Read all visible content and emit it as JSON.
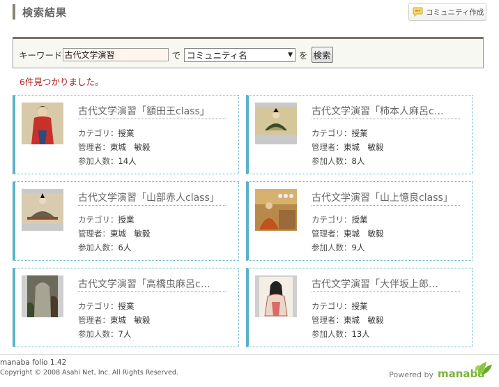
{
  "header": {
    "title": "検索結果",
    "create_button_label": "コミュニティ作成"
  },
  "search": {
    "keyword_label": "キーワード",
    "keyword_value": "古代文学演習",
    "de_label": "で",
    "select_value": "コミュニティ名",
    "wo_label": "を",
    "button_label": "検索"
  },
  "result_count": "6件見つかりました。",
  "labels": {
    "category": "カテゴリ：",
    "manager": "管理者：",
    "members": "参加人数："
  },
  "communities": [
    {
      "name": "古代文学演習「額田王class」",
      "category": "授業",
      "manager": "東城　敏毅",
      "members": "14人",
      "thumb": "red-figure"
    },
    {
      "name": "古代文学演習「柿本人麻呂c…",
      "category": "授業",
      "manager": "東城　敏毅",
      "members": "8人",
      "thumb": "seated-poet"
    },
    {
      "name": "古代文学演習「山部赤人class」",
      "category": "授業",
      "manager": "東城　敏毅",
      "members": "6人",
      "thumb": "seated-noble"
    },
    {
      "name": "古代文学演習「山上憶良class」",
      "category": "授業",
      "manager": "東城　敏毅",
      "members": "9人",
      "thumb": "group-painting"
    },
    {
      "name": "古代文学演習「高橋虫麻呂c…",
      "category": "授業",
      "manager": "東城　敏毅",
      "members": "7人",
      "thumb": "stone-monument"
    },
    {
      "name": "古代文学演習「大伴坂上郎…",
      "category": "授業",
      "manager": "東城　敏毅",
      "members": "13人",
      "thumb": "court-lady"
    }
  ],
  "footer": {
    "version": "manaba folio 1.42",
    "copyright": "Copyright © 2008 Asahi Net, Inc. All Rights Reserved.",
    "powered_by": "Powered by",
    "logo_text": "manaba"
  }
}
